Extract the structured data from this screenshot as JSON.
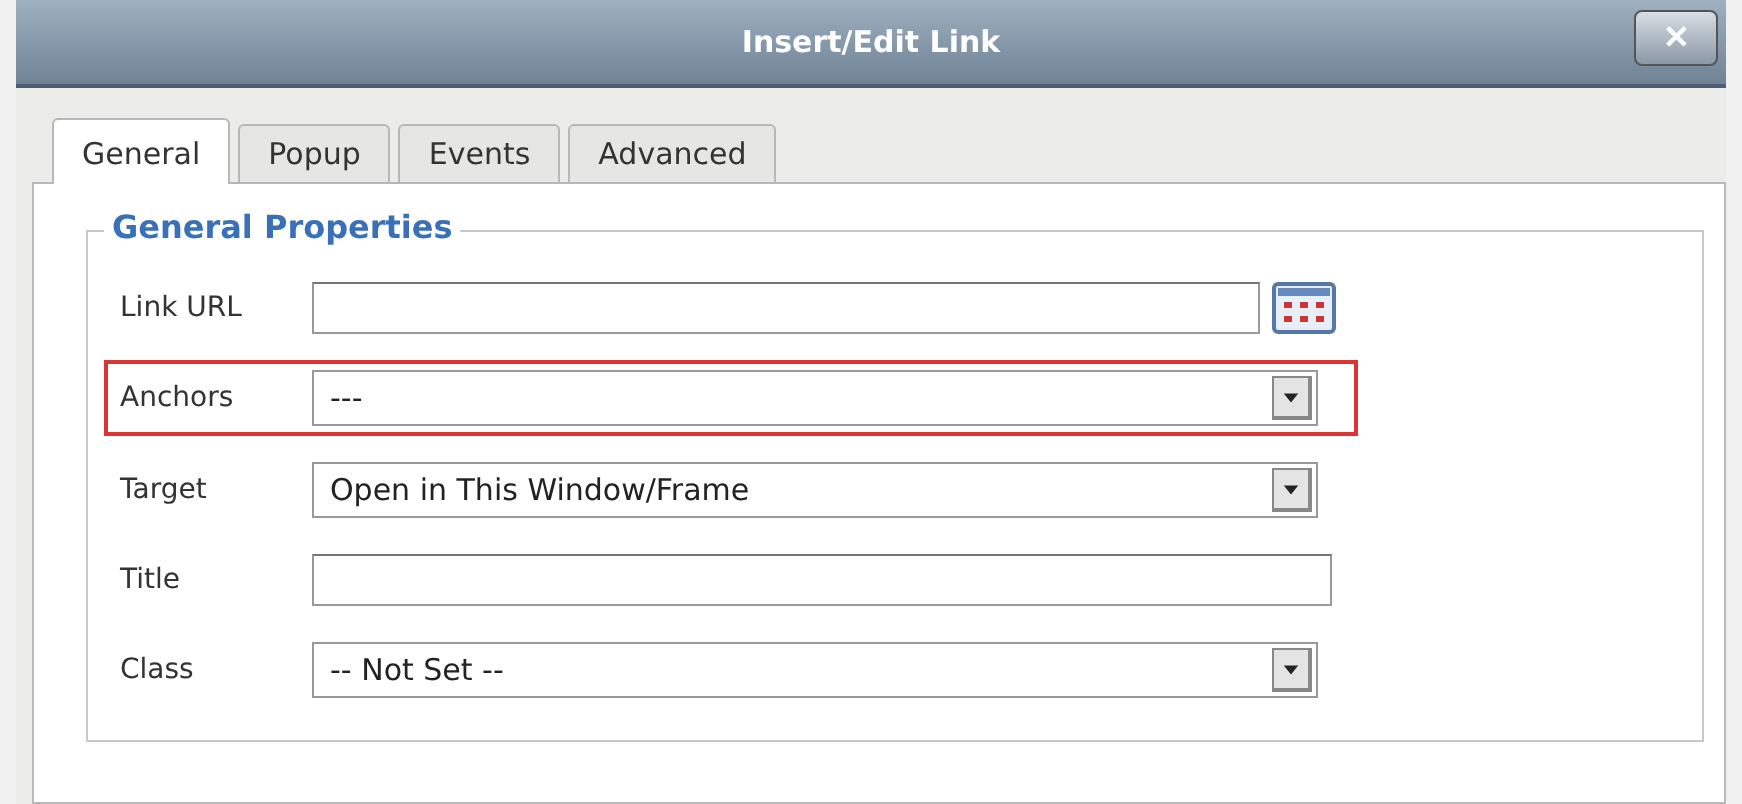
{
  "window": {
    "title": "Insert/Edit Link",
    "close": "✕"
  },
  "tabs": [
    {
      "label": "General",
      "selected": true
    },
    {
      "label": "Popup",
      "selected": false
    },
    {
      "label": "Events",
      "selected": false
    },
    {
      "label": "Advanced",
      "selected": false
    }
  ],
  "fieldset": {
    "legend": "General Properties"
  },
  "fields": [
    {
      "label": "Link URL",
      "kind": "text",
      "browse": true,
      "highlighted": false
    },
    {
      "label": "Anchors",
      "kind": "select",
      "value": "---",
      "highlighted": true
    },
    {
      "label": "Target",
      "kind": "select",
      "value": "Open in This Window/Frame",
      "highlighted": false
    },
    {
      "label": "Title",
      "kind": "text",
      "browse": false,
      "highlighted": false
    },
    {
      "label": "Class",
      "kind": "select",
      "value": "-- Not Set --",
      "highlighted": false
    }
  ]
}
